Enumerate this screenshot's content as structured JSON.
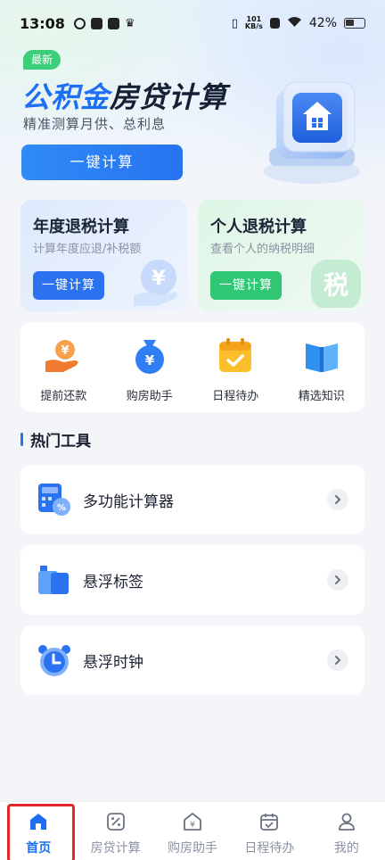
{
  "status_bar": {
    "time": "13:08",
    "net_speed_value": "101",
    "net_speed_unit": "KB/s",
    "battery": "42%"
  },
  "hero": {
    "badge": "最新",
    "title_highlight": "公积金",
    "title_rest": "房贷计算",
    "subtitle": "精准测算月供、总利息",
    "button_label": "一键计算"
  },
  "cards": [
    {
      "title": "年度退税计算",
      "subtitle": "计算年度应退/补税额",
      "button_label": "一键计算",
      "deco_char": "¥"
    },
    {
      "title": "个人退税计算",
      "subtitle": "查看个人的纳税明细",
      "button_label": "一键计算",
      "deco_char": "税"
    }
  ],
  "quick_tools": [
    {
      "label": "提前还款",
      "icon": "hand-coin-icon"
    },
    {
      "label": "购房助手",
      "icon": "money-bag-icon"
    },
    {
      "label": "日程待办",
      "icon": "calendar-check-icon"
    },
    {
      "label": "精选知识",
      "icon": "book-icon"
    }
  ],
  "hot_tools": {
    "title": "热门工具",
    "items": [
      {
        "label": "多功能计算器",
        "icon": "calculator-icon"
      },
      {
        "label": "悬浮标签",
        "icon": "tag-icon"
      },
      {
        "label": "悬浮时钟",
        "icon": "alarm-clock-icon"
      }
    ]
  },
  "bottom_nav": [
    {
      "label": "首页",
      "icon": "home-icon",
      "active": true
    },
    {
      "label": "房贷计算",
      "icon": "percent-icon",
      "active": false
    },
    {
      "label": "购房助手",
      "icon": "house-yen-icon",
      "active": false
    },
    {
      "label": "日程待办",
      "icon": "calendar-icon",
      "active": false
    },
    {
      "label": "我的",
      "icon": "user-icon",
      "active": false
    }
  ],
  "colors": {
    "primary": "#2a72ef",
    "green": "#30c774",
    "active_highlight_box": "#e02a2a"
  }
}
